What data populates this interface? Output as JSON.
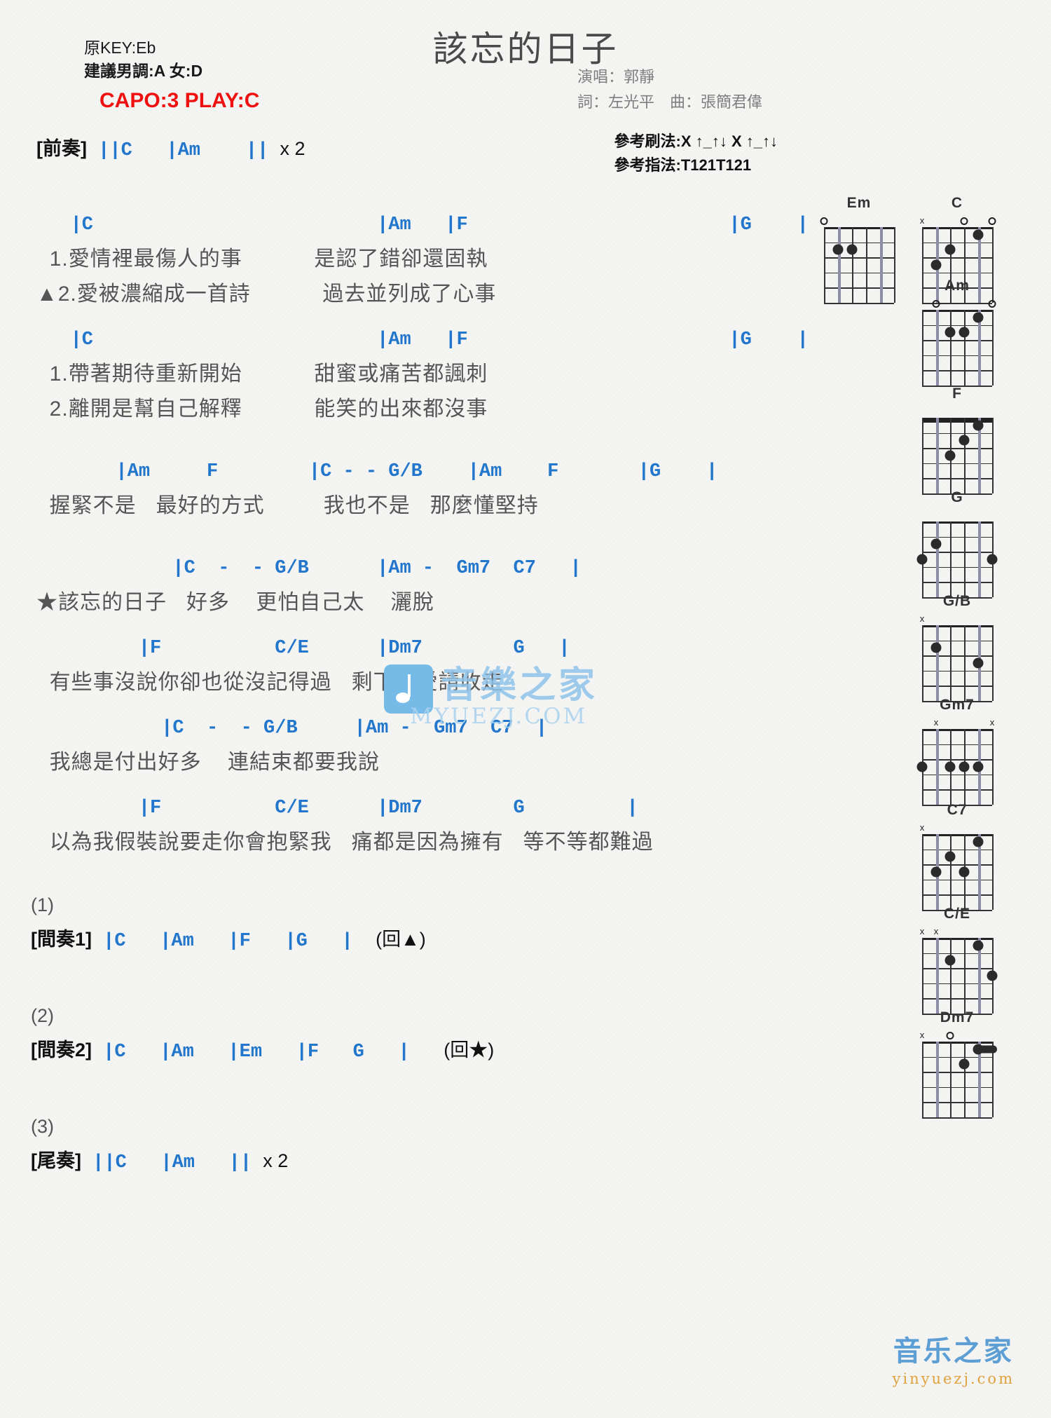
{
  "header": {
    "title": "該忘的日子",
    "original_key_label": "原KEY:Eb",
    "suggested_key_label": "建議男調:A 女:D",
    "capo_label": "CAPO:3 PLAY:C",
    "singer": "演唱：郭靜",
    "lyricist_composer": "詞：左光平　曲：張簡君偉",
    "strum_pattern": "參考刷法:X ↑_↑↓ X ↑_↑↓",
    "finger_pattern": "參考指法:T121T121",
    "capo_color": "#ef1111",
    "chord_color": "#2277cc"
  },
  "sections": [
    {
      "type": "section-line",
      "name": "intro",
      "label": "[前奏]",
      "chords": "||C   |Am    || ",
      "suffix": "x 2"
    },
    {
      "type": "verse",
      "name": "verse-1a",
      "chordline": "   |C                         |Am   |F                       |G    |",
      "lyrics": [
        "  1.愛情裡最傷人的事           是認了錯卻還固執",
        "▲2.愛被濃縮成一首詩           過去並列成了心事"
      ]
    },
    {
      "type": "verse",
      "name": "verse-1b",
      "chordline": "   |C                         |Am   |F                       |G    |",
      "lyrics": [
        "  1.帶著期待重新開始           甜蜜或痛苦都諷刺",
        "  2.離開是幫自己解釋           能笑的出來都沒事"
      ]
    },
    {
      "type": "verse",
      "name": "prechorus",
      "chordline": "       |Am     F        |C - - G/B    |Am    F       |G    |",
      "lyrics": [
        "  握緊不是   最好的方式         我也不是   那麼懂堅持"
      ]
    },
    {
      "type": "verse",
      "name": "chorus-line1",
      "chordline": "            |C  -  - G/B      |Am -  Gm7  C7   |",
      "lyrics": [
        "★該忘的日子   好多    更怕自己太    灑脫"
      ]
    },
    {
      "type": "verse",
      "name": "chorus-line2",
      "chordline": "         |F          C/E      |Dm7        G   |",
      "lyrics": [
        "  有些事沒說你卻也從沒記得過   剩下的愛請收走"
      ]
    },
    {
      "type": "verse",
      "name": "chorus-line3",
      "chordline": "           |C  -  - G/B     |Am -  Gm7  C7  |",
      "lyrics": [
        "  我總是付出好多    連結束都要我說"
      ]
    },
    {
      "type": "verse",
      "name": "chorus-line4",
      "chordline": "         |F          C/E      |Dm7        G         |",
      "lyrics": [
        "  以為我假裝說要走你會抱緊我   痛都是因為擁有   等不等都難過"
      ]
    },
    {
      "type": "marker-section",
      "name": "interlude-1",
      "marker": "(1)",
      "label": "[間奏1]",
      "chords": "|C   |Am   |F   |G   |  ",
      "suffix": "(回▲)"
    },
    {
      "type": "marker-section",
      "name": "interlude-2",
      "marker": "(2)",
      "label": "[間奏2]",
      "chords": "|C   |Am   |Em   |F   G   |   ",
      "suffix": "(回★)"
    },
    {
      "type": "marker-section",
      "name": "outro",
      "marker": "(3)",
      "label": "[尾奏]",
      "chords": "||C   |Am   || ",
      "suffix": "x 2"
    }
  ],
  "chord_diagrams": [
    {
      "name": "Em",
      "marks": [
        {
          "string": 6,
          "type": "open"
        }
      ],
      "dots": [
        {
          "string": 5,
          "fret": 2
        },
        {
          "string": 4,
          "fret": 2
        }
      ],
      "barre": null,
      "barre_nut": false
    },
    {
      "name": "C",
      "marks": [
        {
          "string": 6,
          "type": "muted"
        },
        {
          "string": 3,
          "type": "open"
        },
        {
          "string": 1,
          "type": "open"
        }
      ],
      "dots": [
        {
          "string": 5,
          "fret": 3
        },
        {
          "string": 4,
          "fret": 2
        },
        {
          "string": 2,
          "fret": 1
        }
      ],
      "barre": null,
      "barre_nut": false
    },
    {
      "name": "Am",
      "marks": [
        {
          "string": 5,
          "type": "open"
        },
        {
          "string": 1,
          "type": "open"
        }
      ],
      "dots": [
        {
          "string": 4,
          "fret": 2
        },
        {
          "string": 3,
          "fret": 2
        },
        {
          "string": 2,
          "fret": 1
        }
      ],
      "barre": null,
      "barre_nut": false
    },
    {
      "name": "F",
      "marks": [],
      "dots": [
        {
          "string": 4,
          "fret": 3
        },
        {
          "string": 3,
          "fret": 2
        },
        {
          "string": 2,
          "fret": 1
        }
      ],
      "barre": null,
      "barre_nut": true
    },
    {
      "name": "G",
      "marks": [],
      "dots": [
        {
          "string": 5,
          "fret": 2
        },
        {
          "string": 6,
          "fret": 3
        },
        {
          "string": 1,
          "fret": 3
        }
      ],
      "barre": null,
      "barre_nut": false
    },
    {
      "name": "G/B",
      "marks": [
        {
          "string": 6,
          "type": "muted"
        }
      ],
      "dots": [
        {
          "string": 5,
          "fret": 2
        },
        {
          "string": 2,
          "fret": 3
        }
      ],
      "barre": null,
      "barre_nut": false
    },
    {
      "name": "Gm7",
      "marks": [
        {
          "string": 5,
          "type": "muted"
        },
        {
          "string": 1,
          "type": "muted"
        }
      ],
      "dots": [
        {
          "string": 6,
          "fret": 3
        },
        {
          "string": 4,
          "fret": 3
        },
        {
          "string": 3,
          "fret": 3
        },
        {
          "string": 2,
          "fret": 3
        }
      ],
      "barre": null,
      "barre_nut": false
    },
    {
      "name": "C7",
      "marks": [
        {
          "string": 6,
          "type": "muted"
        }
      ],
      "dots": [
        {
          "string": 5,
          "fret": 3
        },
        {
          "string": 4,
          "fret": 2
        },
        {
          "string": 3,
          "fret": 3
        },
        {
          "string": 2,
          "fret": 1
        }
      ],
      "barre": null,
      "barre_nut": false
    },
    {
      "name": "C/E",
      "marks": [
        {
          "string": 6,
          "type": "muted"
        },
        {
          "string": 5,
          "type": "muted"
        }
      ],
      "dots": [
        {
          "string": 4,
          "fret": 2
        },
        {
          "string": 2,
          "fret": 1
        },
        {
          "string": 1,
          "fret": 3
        }
      ],
      "barre": null,
      "barre_nut": false
    },
    {
      "name": "Dm7",
      "marks": [
        {
          "string": 6,
          "type": "muted"
        },
        {
          "string": 4,
          "type": "open"
        }
      ],
      "dots": [
        {
          "string": 3,
          "fret": 2
        },
        {
          "string": 2,
          "fret": 1
        }
      ],
      "barre": {
        "fret": 1,
        "from": 2,
        "to": 1
      },
      "barre_nut": false
    }
  ],
  "watermarks": {
    "center_cn": "音樂之家",
    "center_en": "MYUEZJ.COM",
    "bottom_cn": "音乐之家",
    "bottom_en": "yinyuezj.com"
  }
}
